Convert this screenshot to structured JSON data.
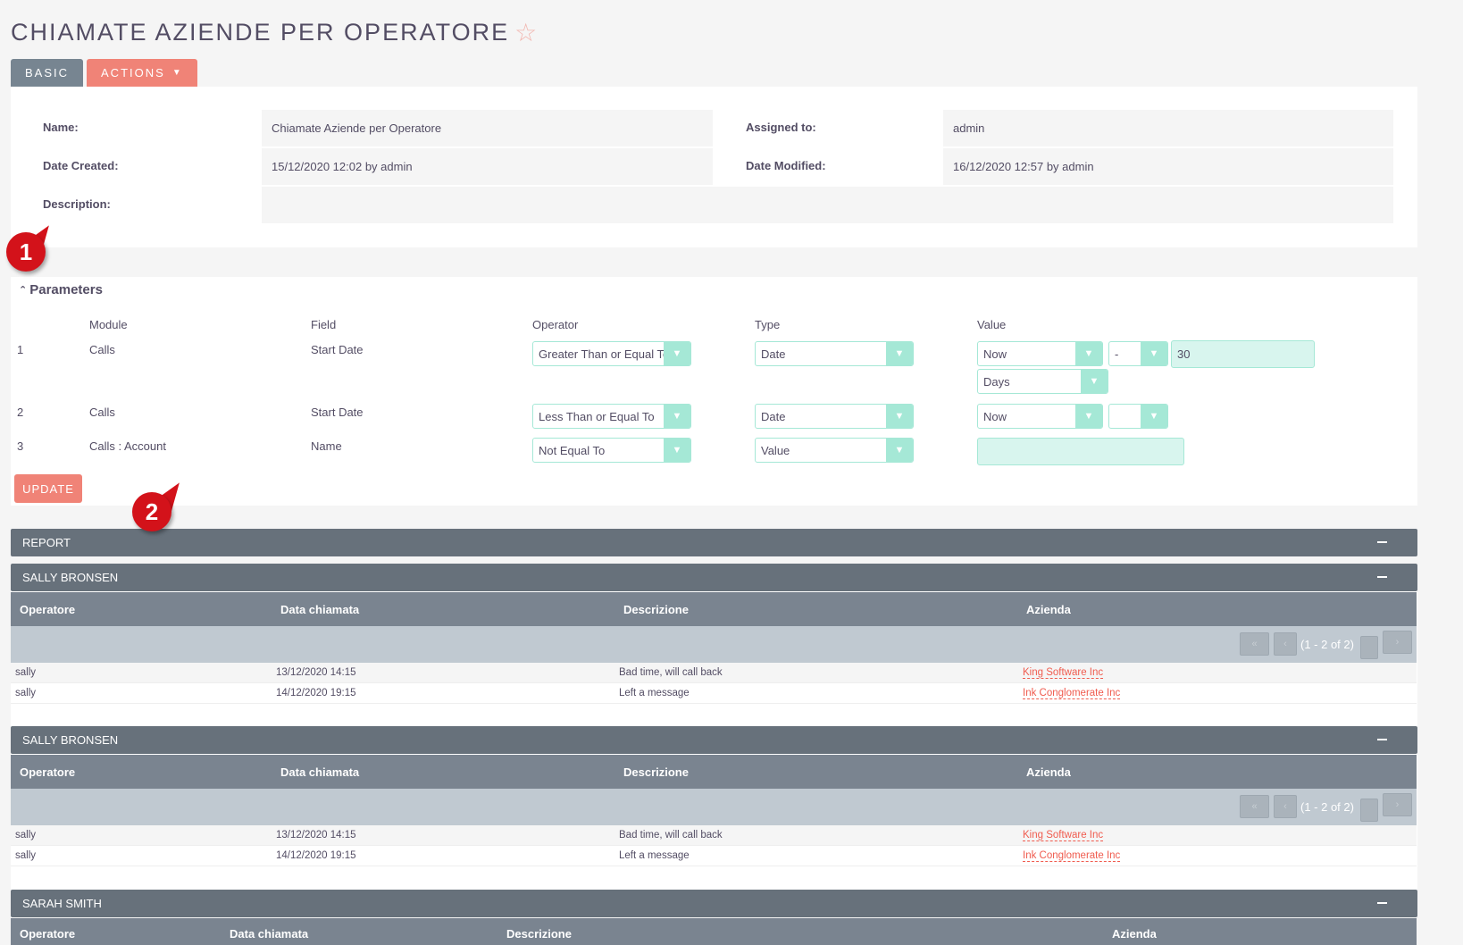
{
  "page": {
    "title": "CHIAMATE AZIENDE PER OPERATORE",
    "favorite_icon": "star-outline-icon"
  },
  "tabs": [
    {
      "label": "BASIC"
    },
    {
      "label": "ACTIONS",
      "icon": "caret-down-icon"
    }
  ],
  "details": {
    "name_label": "Name:",
    "name_value": "Chiamate Aziende per Operatore",
    "assigned_label": "Assigned to:",
    "assigned_value": "admin",
    "date_created_label": "Date Created:",
    "date_created_value": "15/12/2020 12:02 by admin",
    "date_modified_label": "Date Modified:",
    "date_modified_value": "16/12/2020 12:57 by admin",
    "description_label": "Description:",
    "description_value": ""
  },
  "parameters": {
    "title": "Parameters",
    "columns": [
      "Module",
      "Field",
      "Operator",
      "Type",
      "Value"
    ],
    "rows": [
      {
        "num": "1",
        "module": "Calls",
        "field": "Start Date",
        "operator": "Greater Than or Equal To",
        "type": "Date",
        "value_select": "Now",
        "value_sign": "-",
        "value_amount": "30",
        "value_unit": "Days"
      },
      {
        "num": "2",
        "module": "Calls",
        "field": "Start Date",
        "operator": "Less Than or Equal To",
        "type": "Date",
        "value_select": "Now",
        "value_sign": ""
      },
      {
        "num": "3",
        "module": "Calls : Account",
        "field": "Name",
        "operator": "Not Equal To",
        "type": "Value",
        "value_text": ""
      }
    ],
    "update_label": "UPDATE"
  },
  "callouts": [
    "1",
    "2"
  ],
  "report": {
    "title": "REPORT",
    "groups": [
      {
        "title": "SALLY BRONSEN",
        "columns": [
          "Operatore",
          "Data chiamata",
          "Descrizione",
          "Azienda"
        ],
        "pager": "(1 - 2 of 2)",
        "rows": [
          {
            "operatore": "sally",
            "data": "13/12/2020 14:15",
            "descrizione": "Bad time, will call back",
            "azienda": "King Software Inc"
          },
          {
            "operatore": "sally",
            "data": "14/12/2020 19:15",
            "descrizione": "Left a message",
            "azienda": "Ink Conglomerate Inc"
          }
        ]
      },
      {
        "title": "SALLY BRONSEN",
        "columns": [
          "Operatore",
          "Data chiamata",
          "Descrizione",
          "Azienda"
        ],
        "pager": "(1 - 2 of 2)",
        "rows": [
          {
            "operatore": "sally",
            "data": "13/12/2020 14:15",
            "descrizione": "Bad time, will call back",
            "azienda": "King Software Inc"
          },
          {
            "operatore": "sally",
            "data": "14/12/2020 19:15",
            "descrizione": "Left a message",
            "azienda": "Ink Conglomerate Inc"
          }
        ]
      },
      {
        "title": "SARAH SMITH",
        "columns": [
          "Operatore",
          "Data chiamata",
          "Descrizione",
          "Azienda"
        ]
      }
    ]
  },
  "colors": {
    "accent": "#f08377",
    "tab_basic": "#778591",
    "bar": "#67717b",
    "table_header": "#7a8490",
    "pager_row": "#c0c9d1",
    "select_border": "#a5e8d6",
    "link": "#f05c4f",
    "callout": "#d3121a"
  }
}
